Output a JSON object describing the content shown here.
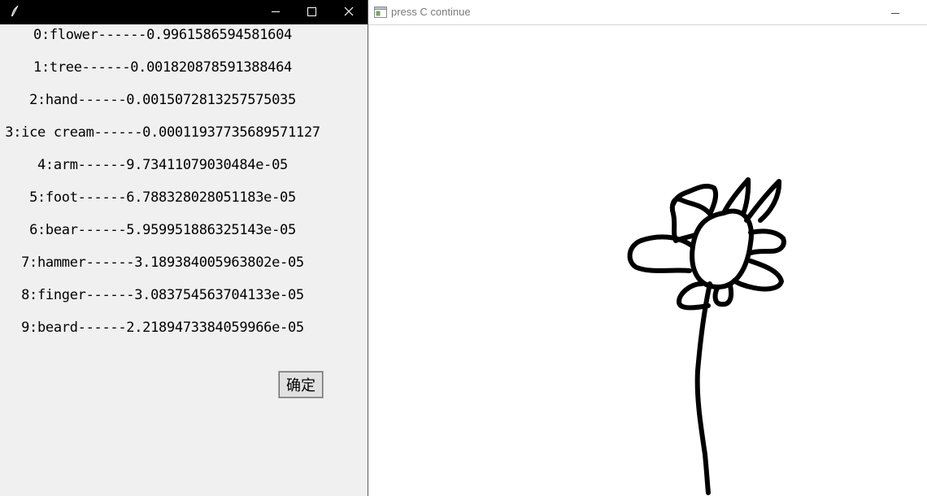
{
  "prediction_window": {
    "results": [
      {
        "text": "0:flower------0.9961586594581604"
      },
      {
        "text": "1:tree------0.001820878591388464"
      },
      {
        "text": "2:hand------0.0015072813257575035"
      },
      {
        "text": "3:ice cream------0.00011937735689571127"
      },
      {
        "text": "4:arm------9.73411079030484e-05"
      },
      {
        "text": "5:foot------6.788328028051183e-05"
      },
      {
        "text": "6:bear------5.959951886325143e-05"
      },
      {
        "text": "7:hammer------3.189384005963802e-05"
      },
      {
        "text": "8:finger------3.083754563704133e-05"
      },
      {
        "text": "9:beard------2.2189473384059966e-05"
      }
    ],
    "ok_label": "确定",
    "icons": {
      "app": "feather-icon",
      "minimize": "minimize-icon",
      "maximize": "maximize-icon",
      "close": "close-icon"
    }
  },
  "canvas_window": {
    "title": "press C continue",
    "icons": {
      "app": "window-icon",
      "minimize": "minimize-icon"
    },
    "stroke_color": "#000000"
  },
  "colors": {
    "tk_background": "#f0f0f0",
    "tk_titlebar": "#000000",
    "canvas_background": "#ffffff"
  }
}
